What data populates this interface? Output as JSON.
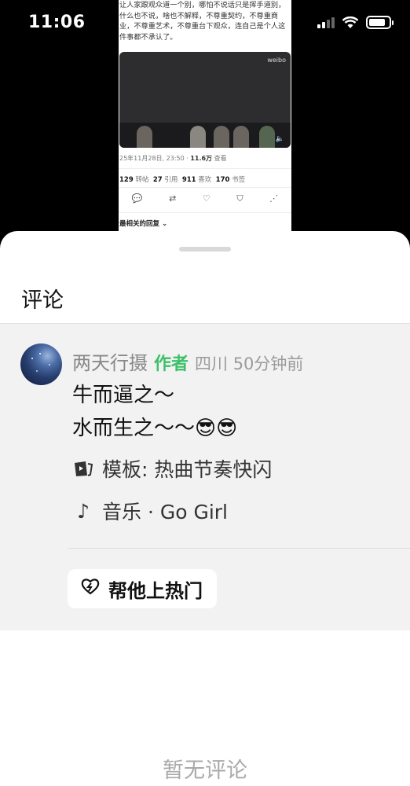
{
  "status_bar": {
    "time": "11:06",
    "battery_level": 0.85
  },
  "background_post": {
    "text": "让人家跟观众道一个别，哪怕不说话只是挥手道别，什么也不说，啥也不解释，不尊重契约，不尊重商业，不尊重艺术，不尊重台下观众，连自己是个人这件事都不承认了。",
    "video_watermark": "weibo",
    "date": "25年11月28日, 23:50 · ",
    "views": "11.6万",
    "views_label": " 查看",
    "reposts": "129",
    "reposts_label": " 转帖",
    "quotes": "27",
    "quotes_label": " 引用",
    "likes": "911",
    "likes_label": " 喜欢",
    "bookmarks": "170",
    "bookmarks_label": " 书签",
    "sort_label": "最相关的回复 ⌄"
  },
  "sheet": {
    "title": "评论",
    "comment": {
      "name": "两天行摄",
      "author_tag": "作者",
      "location_time": "四川 50分钟前",
      "line1": "牛而逼之～",
      "line2": "水而生之～～😎😎",
      "template": "模板: 热曲节奏快闪",
      "music": "音乐 · Go Girl",
      "hot_button": "帮他上热门"
    },
    "empty_text": "暂无评论"
  }
}
